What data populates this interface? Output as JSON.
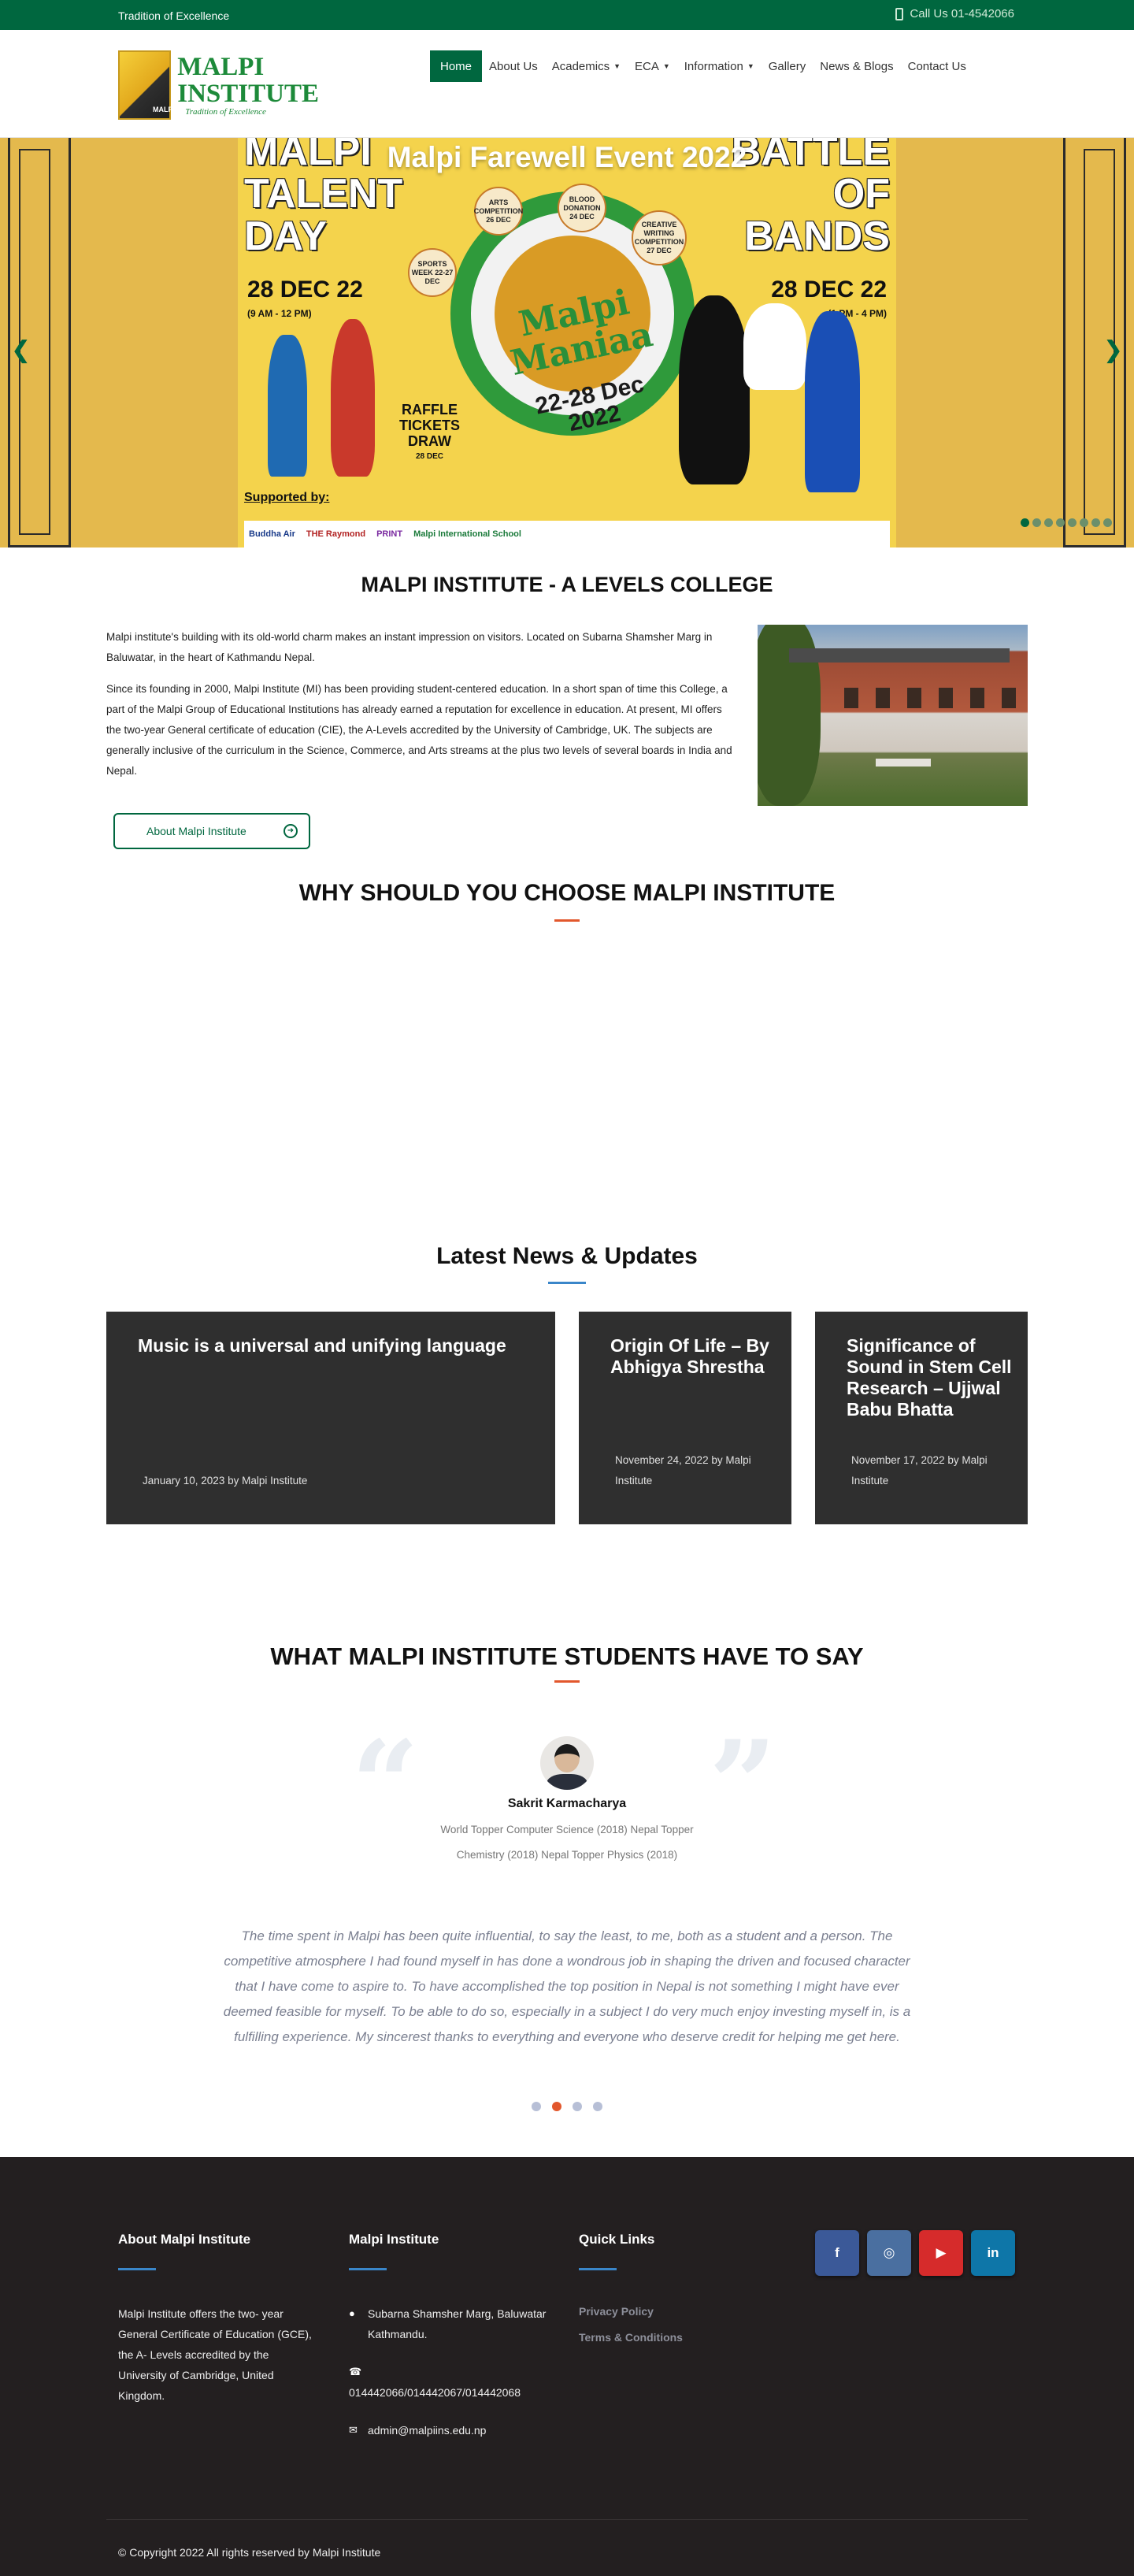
{
  "topbar": {
    "tagline": "Tradition of Excellence",
    "call": "Call Us 01-4542066"
  },
  "brand": {
    "name_line1": "MALPI",
    "name_line2": "INSTITUTE",
    "subtitle": "Tradition of Excellence",
    "mark_text": "MALPI"
  },
  "nav": {
    "items": [
      {
        "label": "Home",
        "active": true
      },
      {
        "label": "About Us"
      },
      {
        "label": "Academics",
        "dropdown": true
      },
      {
        "label": "ECA",
        "dropdown": true
      },
      {
        "label": "Information",
        "dropdown": true
      },
      {
        "label": "Gallery"
      },
      {
        "label": "News & Blogs"
      },
      {
        "label": "Contact Us"
      }
    ]
  },
  "hero": {
    "slide_title": "Malpi Farewell Event 2022",
    "poster": {
      "left_heading": "MALPI\nTALENT\nDAY",
      "right_heading": "BATTLE\nOF\nBANDS",
      "left_date": "28 DEC 22",
      "left_time": "(9 AM - 12 PM)",
      "right_date": "28 DEC 22",
      "right_time": "(1 PM - 4 PM)",
      "event_name": "Malpi\nManiaa",
      "event_dates": "22-28 Dec\n2022",
      "bubbles": [
        {
          "text": "ARTS COMPETITION 26 DEC"
        },
        {
          "text": "BLOOD DONATION 24 DEC"
        },
        {
          "text": "CREATIVE WRITING COMPETITION 27 DEC"
        },
        {
          "text": "SPORTS WEEK 22-27 DEC"
        }
      ],
      "raffle": "RAFFLE\nTICKETS\nDRAW",
      "raffle_date": "28 DEC",
      "supported_by": "Supported by:",
      "sponsors": [
        "Buddha Air",
        "THE Raymond",
        "PRINT",
        "Malpi International School"
      ]
    },
    "slide_count": 8,
    "active_slide": 0
  },
  "about": {
    "title": "MALPI INSTITUTE - A LEVELS COLLEGE",
    "paragraphs": [
      "Malpi institute's building with its old-world charm makes an instant impression on visitors. Located on Subarna Shamsher Marg in Baluwatar, in the heart of Kathmandu Nepal.",
      "Since its founding in 2000, Malpi Institute (MI) has been providing student-centered education. In a short span of time this College, a part of the Malpi Group of Educational Institutions has already earned a reputation for excellence in education. At present, MI offers the two-year General certificate of education (CIE), the A-Levels accredited by the University of Cambridge, UK. The subjects are generally inclusive of the curriculum in the Science, Commerce, and Arts streams at the plus two levels of several boards in India and Nepal."
    ],
    "button": "About Malpi Institute"
  },
  "why": {
    "title": "WHY SHOULD YOU CHOOSE MALPI INSTITUTE"
  },
  "news": {
    "title": "Latest News & Updates",
    "items": [
      {
        "title": "Music is a universal and unifying language",
        "meta": "January 10, 2023 by Malpi Institute"
      },
      {
        "title": "Origin Of Life – By Abhigya Shrestha",
        "meta": "November 24, 2022 by Malpi Institute"
      },
      {
        "title": "Significance of Sound in Stem Cell Research – Ujjwal Babu Bhatta",
        "meta": "November 17, 2022 by Malpi Institute"
      }
    ]
  },
  "testimonials": {
    "title": "WHAT MALPI INSTITUTE STUDENTS HAVE TO SAY",
    "name": "Sakrit Karmacharya",
    "role": "World Topper Computer Science (2018) Nepal Topper Chemistry (2018) Nepal Topper Physics (2018)",
    "quote": "The time spent in Malpi has been quite influential, to say the least, to me, both as a student and a person. The competitive atmosphere I had found myself in has done a wondrous job in shaping the driven and focused character that I have come to aspire to. To have accomplished the top position in Nepal is not something I might have ever deemed feasible for myself. To be able to do so, especially in a subject I do very much enjoy investing myself in, is a fulfilling experience. My sincerest thanks to everything and everyone who deserve credit for helping me get here.",
    "dot_count": 4,
    "active_dot": 1
  },
  "footer": {
    "about_heading": "About Malpi Institute",
    "about_text": "Malpi Institute offers the two- year General Certificate of Education (GCE), the A- Levels accredited by the University of Cambridge, United Kingdom.",
    "contact_heading": "Malpi Institute",
    "address": "Subarna Shamsher Marg, Baluwatar Kathmandu.",
    "phones": "014442066/014442067/014442068",
    "email": "admin@malpiins.edu.np",
    "links_heading": "Quick Links",
    "links": [
      "Privacy Policy",
      "Terms & Conditions"
    ],
    "socials": [
      {
        "name": "facebook",
        "glyph": "f",
        "color": "#3b5998"
      },
      {
        "name": "instagram",
        "glyph": "◎",
        "color": "#4a6fa0"
      },
      {
        "name": "youtube",
        "glyph": "▶",
        "color": "#d62b2b"
      },
      {
        "name": "linkedin",
        "glyph": "in",
        "color": "#0e76a8"
      }
    ],
    "copyright": "© Copyright 2022 All rights reserved by Malpi Institute"
  },
  "colors": {
    "brand_green": "#00673f",
    "accent_orange": "#e2572c",
    "accent_blue": "#3a86c9",
    "footer_bg": "#231f20",
    "card_bg": "#2f2f2f"
  }
}
